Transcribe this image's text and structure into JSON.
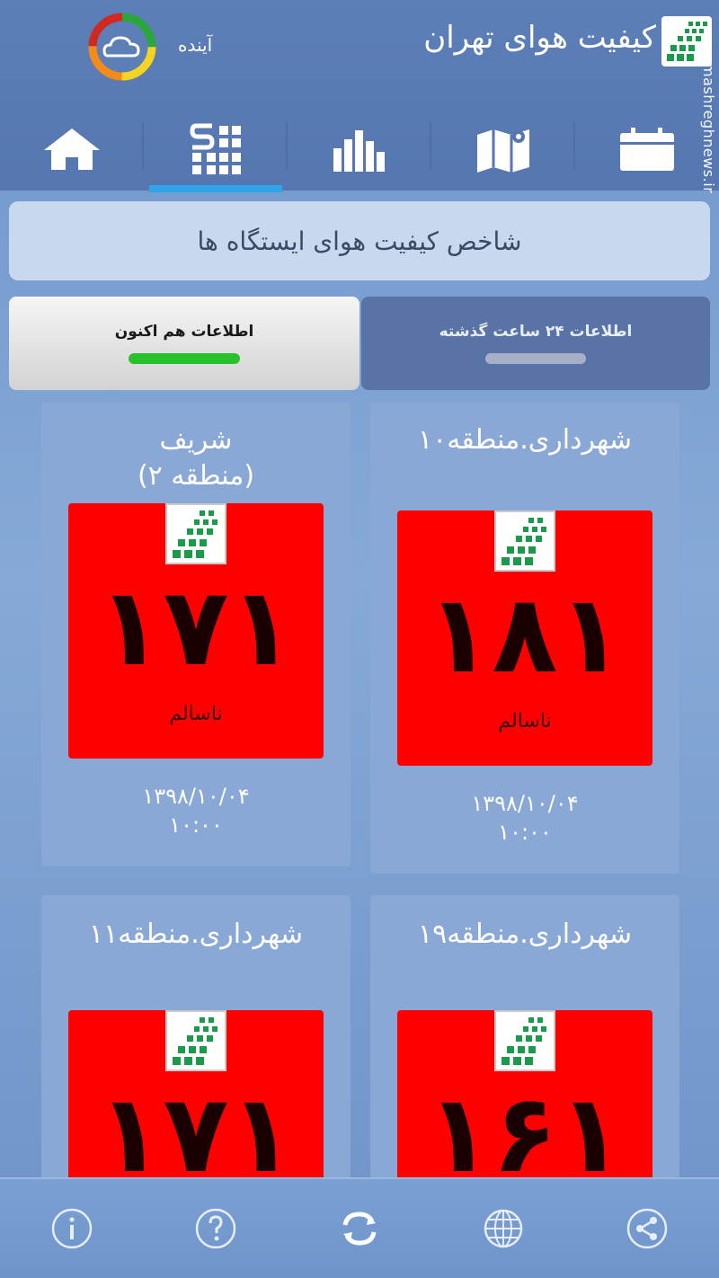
{
  "app": {
    "title": "کیفیت هوای تهران",
    "watermark": "mashreghnews.ir",
    "forecast_label": "آینده"
  },
  "tabs": [
    {
      "icon": "home-icon"
    },
    {
      "icon": "station-index-icon",
      "active": true
    },
    {
      "icon": "bar-chart-icon"
    },
    {
      "icon": "map-icon"
    },
    {
      "icon": "calendar-icon"
    }
  ],
  "header": {
    "title": "شاخص کیفیت هوای ایستگاه ها"
  },
  "toggle": {
    "now_label": "اطلاعات هم اکنون",
    "past_label": "اطلاعات ۲۴ ساعت گذشته"
  },
  "stations": [
    {
      "name_line1": "شهرداری.منطقه۱۰",
      "name_line2": "",
      "aqi": "۱۸۱",
      "status": "ناسالم",
      "date": "۱۳۹۸/۱۰/۰۴",
      "time": "۱۰:۰۰",
      "color": "#ff0000"
    },
    {
      "name_line1": "شریف",
      "name_line2": "(منطقه ۲)",
      "aqi": "۱۷۱",
      "status": "ناسالم",
      "date": "۱۳۹۸/۱۰/۰۴",
      "time": "۱۰:۰۰",
      "color": "#ff0000"
    },
    {
      "name_line1": "شهرداری.منطقه۱۹",
      "name_line2": "",
      "aqi": "۱۶۱",
      "status": "",
      "date": "",
      "time": "",
      "color": "#ff0000"
    },
    {
      "name_line1": "شهرداری.منطقه۱۱",
      "name_line2": "",
      "aqi": "۱۷۱",
      "status": "",
      "date": "",
      "time": "",
      "color": "#ff0000"
    }
  ],
  "bottom_nav": [
    {
      "icon": "info-icon"
    },
    {
      "icon": "help-icon"
    },
    {
      "icon": "refresh-icon"
    },
    {
      "icon": "globe-icon"
    },
    {
      "icon": "share-icon"
    }
  ],
  "colors": {
    "unhealthy": "#ff0000",
    "active_tab_underline": "#2fa4e8",
    "now_indicator": "#29c12b"
  }
}
